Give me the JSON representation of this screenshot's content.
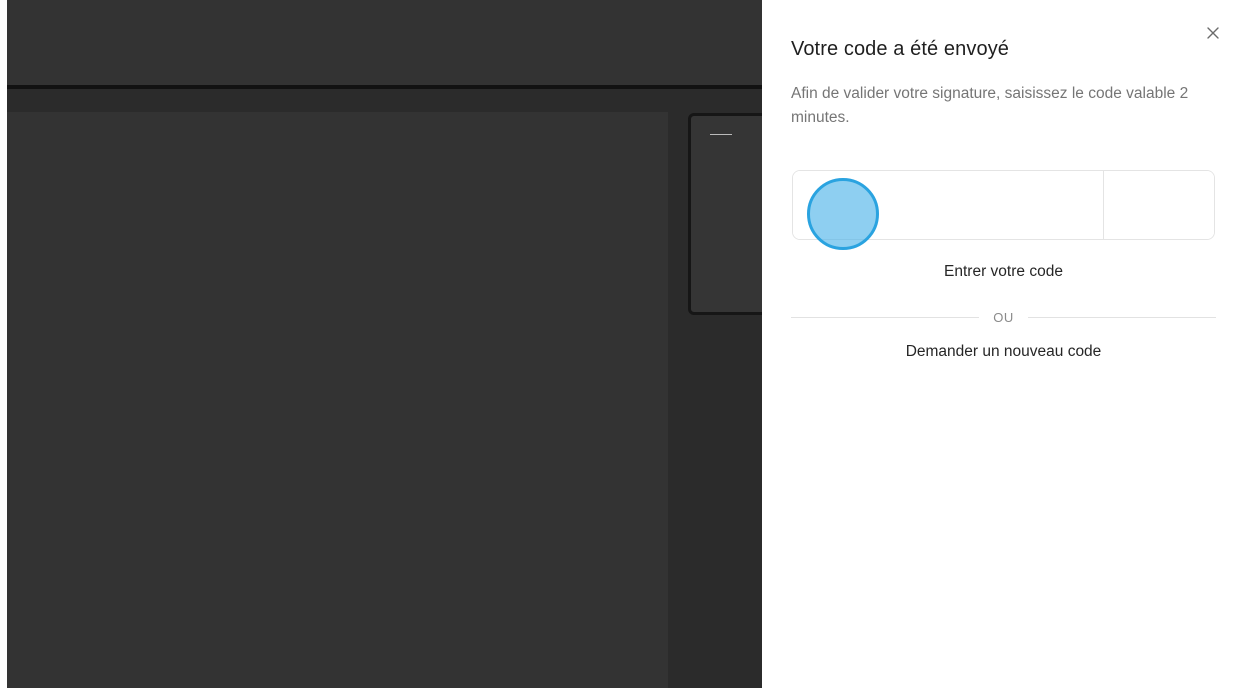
{
  "drawer": {
    "title": "Votre code a été envoyé",
    "description": "Afin de valider votre signature, saisissez le code valable 2 minutes.",
    "code_inputs": [
      "",
      "",
      "",
      "",
      "",
      ""
    ],
    "enter_label": "Entrer votre code",
    "or_label": "OU",
    "new_code_label": "Demander un nouveau code",
    "close_icon": "close-icon"
  },
  "colors": {
    "backdrop": "#2b2b2b",
    "click_indicator": "#48b2e8"
  }
}
